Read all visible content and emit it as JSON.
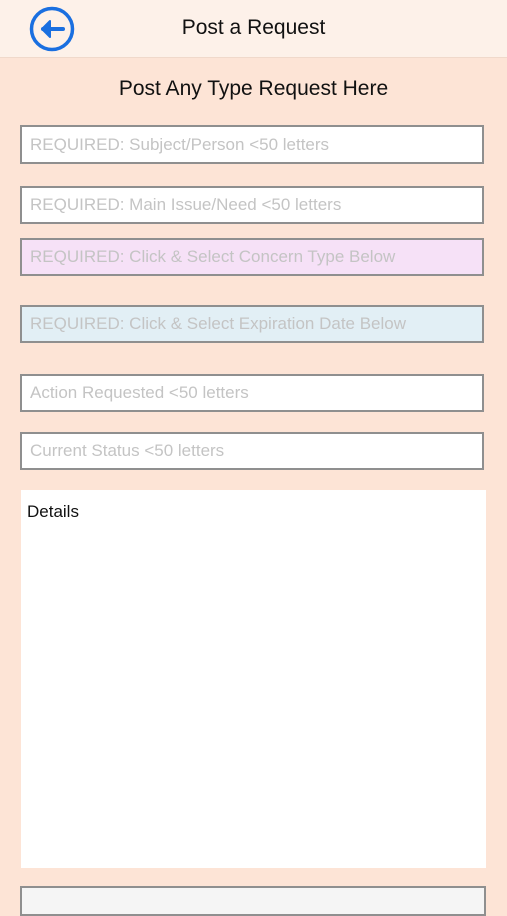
{
  "header": {
    "title": "Post a Request",
    "back_icon": "arrow-left-circle-icon",
    "accent_color": "#1a6fe0"
  },
  "form": {
    "heading": "Post Any Type Request Here",
    "subject_placeholder": "REQUIRED: Subject/Person <50 letters",
    "issue_placeholder": "REQUIRED: Main Issue/Need <50 letters",
    "concern_placeholder": "REQUIRED: Click & Select Concern Type Below",
    "expiration_placeholder": "REQUIRED: Click & Select Expiration Date Below",
    "action_placeholder": "Action Requested <50 letters",
    "status_placeholder": "Current Status <50 letters",
    "details_label": "Details",
    "colors": {
      "background": "#fde4d6",
      "concern_field": "#f6e1f7",
      "expiration_field": "#e2eff5"
    }
  }
}
